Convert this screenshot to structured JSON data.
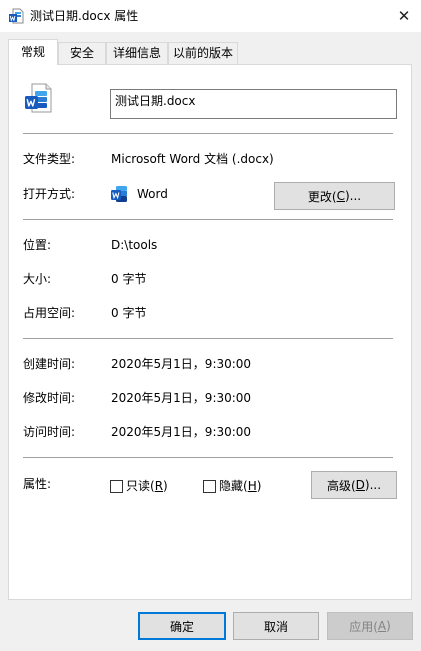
{
  "window": {
    "title": "测试日期.docx 属性",
    "close_glyph": "✕"
  },
  "tabs": [
    {
      "label": "常规"
    },
    {
      "label": "安全"
    },
    {
      "label": "详细信息"
    },
    {
      "label": "以前的版本"
    }
  ],
  "file": {
    "name": "测试日期.docx",
    "type_label": "文件类型:",
    "type_value": "Microsoft Word 文档 (.docx)",
    "open_with_label": "打开方式:",
    "open_with_app": "Word",
    "change_button_pre": "更改(",
    "change_button_key": "C",
    "change_button_post": ")...",
    "location_label": "位置:",
    "location_value": "D:\\tools",
    "size_label": "大小:",
    "size_value": "0 字节",
    "disk_size_label": "占用空间:",
    "disk_size_value": "0 字节",
    "created_label": "创建时间:",
    "created_value": "2020年5月1日，9:30:00",
    "modified_label": "修改时间:",
    "modified_value": "2020年5月1日，9:30:00",
    "accessed_label": "访问时间:",
    "accessed_value": "2020年5月1日，9:30:00"
  },
  "attributes": {
    "label": "属性:",
    "readonly_pre": "只读(",
    "readonly_key": "R",
    "readonly_post": ")",
    "hidden_pre": "隐藏(",
    "hidden_key": "H",
    "hidden_post": ")",
    "advanced_pre": "高级(",
    "advanced_key": "D",
    "advanced_post": ")..."
  },
  "footer": {
    "ok": "确定",
    "cancel": "取消",
    "apply_pre": "应用(",
    "apply_key": "A",
    "apply_post": ")"
  },
  "colors": {
    "accent": "#0078d7",
    "word_blue": "#185abd",
    "word_dark": "#103f91",
    "word_light": "#41a5ee"
  },
  "icons": {
    "title": "word-doc-icon",
    "file": "word-doc-icon",
    "app": "word-app-icon",
    "close": "close-icon"
  }
}
